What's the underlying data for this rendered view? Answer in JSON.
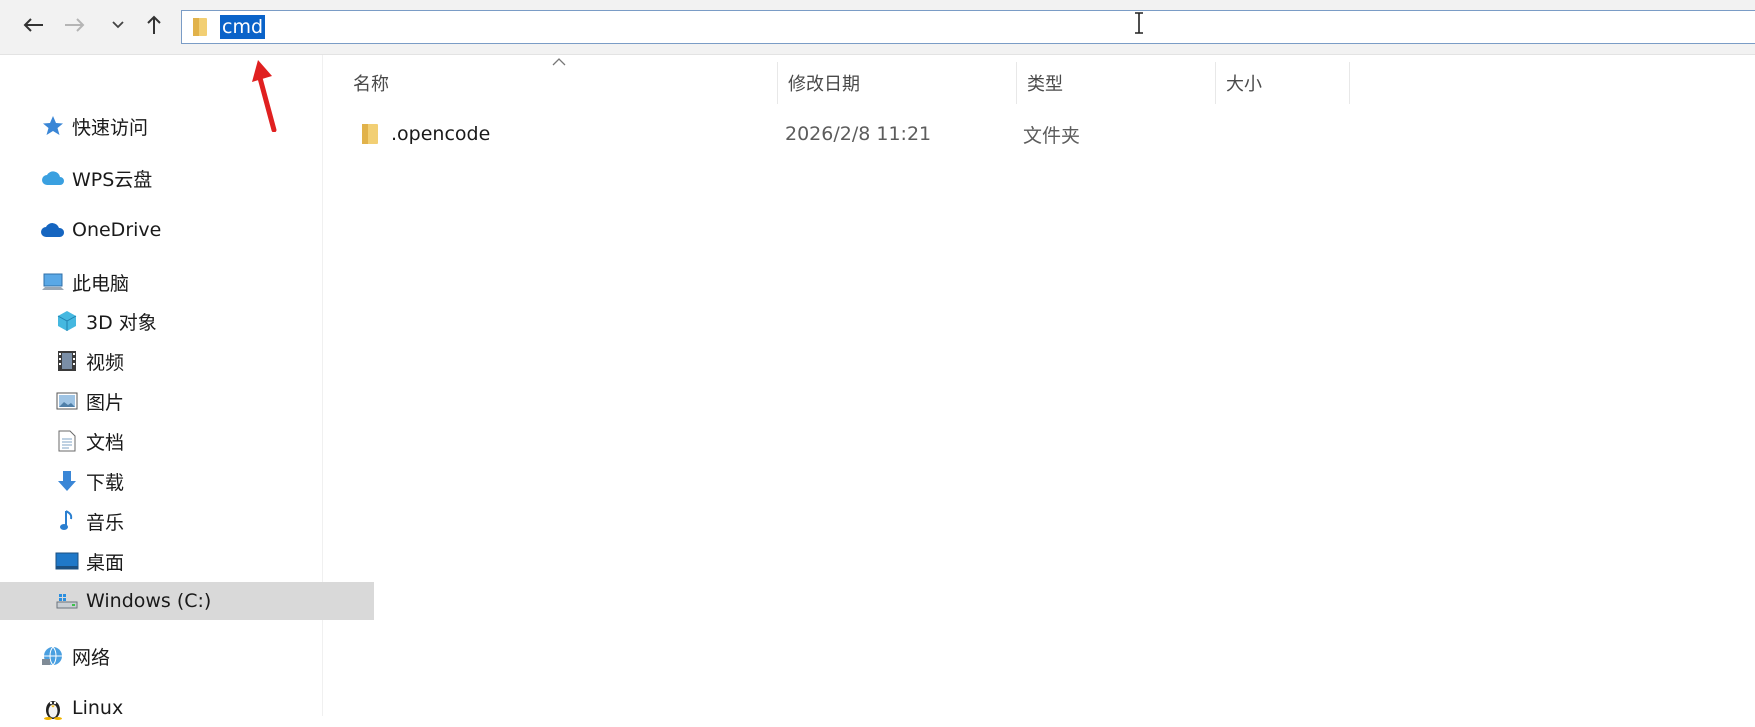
{
  "address_bar": {
    "value": "cmd"
  },
  "sidebar": {
    "items": [
      {
        "label": "快速访问",
        "icon": "star-icon"
      },
      {
        "label": "WPS云盘",
        "icon": "cloud-icon"
      },
      {
        "label": "OneDrive",
        "icon": "onedrive-icon"
      },
      {
        "label": "此电脑",
        "icon": "computer-icon"
      },
      {
        "label": "3D 对象",
        "icon": "cube-icon"
      },
      {
        "label": "视频",
        "icon": "film-icon"
      },
      {
        "label": "图片",
        "icon": "picture-icon"
      },
      {
        "label": "文档",
        "icon": "document-icon"
      },
      {
        "label": "下载",
        "icon": "download-icon"
      },
      {
        "label": "音乐",
        "icon": "music-icon"
      },
      {
        "label": "桌面",
        "icon": "desktop-icon"
      },
      {
        "label": "Windows (C:)",
        "icon": "drive-icon",
        "selected": true
      },
      {
        "label": "网络",
        "icon": "network-icon"
      },
      {
        "label": "Linux",
        "icon": "linux-icon"
      }
    ]
  },
  "columns": {
    "name": "名称",
    "modified": "修改日期",
    "type": "类型",
    "size": "大小"
  },
  "files": [
    {
      "name": ".opencode",
      "modified": "2026/2/8 11:21",
      "type": "文件夹",
      "size": ""
    }
  ],
  "colors": {
    "accent": "#0a63c9",
    "annotation_arrow": "#e02020",
    "folder": "#e8b84a"
  }
}
